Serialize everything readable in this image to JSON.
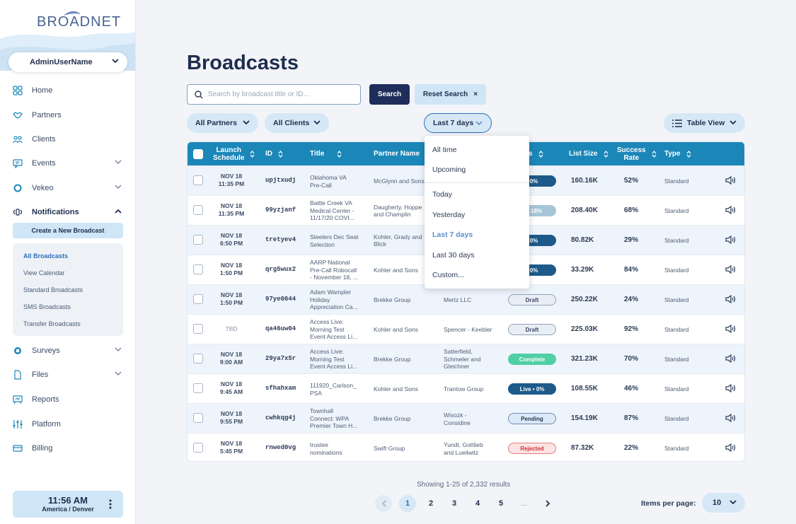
{
  "app": {
    "logo": "BROADNET"
  },
  "user": {
    "name": "AdminUserName"
  },
  "nav": {
    "home": "Home",
    "partners": "Partners",
    "clients": "Clients",
    "events": "Events",
    "vekeo": "Vekeo",
    "notifications": "Notifications",
    "create_broadcast": "Create a New Broadcast",
    "sub": {
      "all": "All Broadcasts",
      "calendar": "View Calendar",
      "standard": "Standard Broadcasts",
      "sms": "SMS Broadcasts",
      "transfer": "Transfer Broadcasts"
    },
    "surveys": "Surveys",
    "files": "Files",
    "reports": "Reports",
    "platform": "Platform",
    "billing": "Billing"
  },
  "clock": {
    "time": "11:56 AM",
    "zone": "America / Denver"
  },
  "page": {
    "title": "Broadcasts"
  },
  "search": {
    "placeholder": "Search by broadcast title or ID...",
    "button": "Search",
    "reset": "Reset Search",
    "reset_icon": "×"
  },
  "filters": {
    "partners": "All Partners",
    "clients": "All Clients",
    "date": "Last 7 days",
    "view": "Table View"
  },
  "table": {
    "headers": {
      "launch": [
        "Launch",
        "Schedule"
      ],
      "id": "ID",
      "title": "Title",
      "partner": "Partner Name",
      "status": "s",
      "list_size": "List Size",
      "success": [
        "Success",
        "Rate"
      ],
      "type": "Type"
    },
    "rows": [
      {
        "date": [
          "NOV 18",
          "11:35 PM"
        ],
        "id": "upjtxudj",
        "title": [
          "Oklahoma VA",
          "Pre-Call"
        ],
        "partner": [
          "McGlynn and Sons"
        ],
        "client": [],
        "status": "• 0%",
        "status_kind": "live",
        "size": "160.16K",
        "rate": "52%",
        "type": "Standard"
      },
      {
        "date": [
          "NOV 18",
          "11:35 PM"
        ],
        "id": "99yzjanf",
        "title": [
          "Battle Creek VA",
          "Medical Center -",
          "11/17/20 COVI..."
        ],
        "partner": [
          "Daugherty, Hoppe",
          "and Champlin"
        ],
        "client": [],
        "status": "d • 18%",
        "status_kind": "paused",
        "size": "208.40K",
        "rate": "68%",
        "type": "Standard"
      },
      {
        "date": [
          "NOV 18",
          "6:50 PM"
        ],
        "id": "tretyev4",
        "title": [
          "Steelers Dec Seat",
          "Selection"
        ],
        "partner": [
          "Kohler, Grady and",
          "Blick"
        ],
        "client": [],
        "status": "• 0%",
        "status_kind": "live",
        "size": "80.82K",
        "rate": "29%",
        "type": "Standard"
      },
      {
        "date": [
          "NOV 18",
          "1:50 PM"
        ],
        "id": "qrg5wux2",
        "title": [
          "AARP National",
          "Pre-Call Robocall",
          "- November 18, ..."
        ],
        "partner": [
          "Kohler and Sons"
        ],
        "client": [],
        "status": "• 0%",
        "status_kind": "live",
        "size": "33.29K",
        "rate": "84%",
        "type": "Standard"
      },
      {
        "date": [
          "NOV 18",
          "1:50 PM"
        ],
        "id": "97ye0644",
        "title": [
          "Adam Wampler",
          "Holiday",
          "Appreciation Ca..."
        ],
        "partner": [
          "Brekke Group"
        ],
        "client": [
          "Mertz LLC"
        ],
        "status": "Draft",
        "status_kind": "draft",
        "size": "250.22K",
        "rate": "24%",
        "type": "Standard"
      },
      {
        "date": [
          "TBD"
        ],
        "id": "qa46uw04",
        "title": [
          "Access Live:",
          "Morning Test",
          "Event Access Li..."
        ],
        "partner": [
          "Kohler and Sons"
        ],
        "client": [
          "Spencer - Keebler"
        ],
        "status": "Draft",
        "status_kind": "draft",
        "size": "225.03K",
        "rate": "92%",
        "type": "Standard"
      },
      {
        "date": [
          "NOV 18",
          "9:00 AM"
        ],
        "id": "29ya7x5r",
        "title": [
          "Access Live:",
          "Morning Test",
          "Event Access Li..."
        ],
        "partner": [
          "Brekke Group"
        ],
        "client": [
          "Satterfield,",
          "Schmeler and",
          "Gleichner"
        ],
        "status": "Complete",
        "status_kind": "complete",
        "size": "321.23K",
        "rate": "70%",
        "type": "Standard"
      },
      {
        "date": [
          "NOV 18",
          "9:45 AM"
        ],
        "id": "sfhahxam",
        "title": [
          "111920_Carlson_",
          "PSA"
        ],
        "partner": [
          "Kohler and Sons"
        ],
        "client": [
          "Trantow Group"
        ],
        "status": "Live • 0%",
        "status_kind": "live",
        "size": "108.55K",
        "rate": "46%",
        "type": "Standard"
      },
      {
        "date": [
          "NOV 18",
          "9:55 PM"
        ],
        "id": "cwhkqg4j",
        "title": [
          "Townhall",
          "Connect: WPA",
          "Premier Town H..."
        ],
        "partner": [
          "Brekke Group"
        ],
        "client": [
          "Wisozk -",
          "Considine"
        ],
        "status": "Pending",
        "status_kind": "pending",
        "size": "154.19K",
        "rate": "87%",
        "type": "Standard"
      },
      {
        "date": [
          "NOV 18",
          "5:45 PM"
        ],
        "id": "rnwed0vg",
        "title": [
          "trustee",
          "nominations"
        ],
        "partner": [
          "Swift Group"
        ],
        "client": [
          "Yundt, Gottlieb",
          "and Lueilwitz"
        ],
        "status": "Rejected",
        "status_kind": "rejected",
        "size": "87.32K",
        "rate": "22%",
        "type": "Standard"
      }
    ]
  },
  "date_dropdown": {
    "options": [
      "All time",
      "Upcoming",
      "Today",
      "Yesterday",
      "Last 7 days",
      "Last 30 days",
      "Custom..."
    ],
    "selected": "Last 7 days"
  },
  "pagination": {
    "summary": "Showing 1-25 of 2,332 results",
    "pages": [
      "1",
      "2",
      "3",
      "4",
      "5",
      "..."
    ],
    "current": "1",
    "items_per_page_label": "Items per page:",
    "items_per_page": "10"
  },
  "colors": {
    "header": "#1b87b8",
    "navy": "#1f2d5a",
    "accent": "#2d6fb8",
    "complete": "#4fcfa4",
    "rejected": "#d0333a"
  },
  "icons": {
    "nav": [
      "grid-icon",
      "handshake-icon",
      "users-icon",
      "chat-icon",
      "vekeo-icon",
      "broadcast-icon",
      "surveys-icon",
      "file-icon",
      "reports-icon",
      "sliders-icon",
      "card-icon"
    ],
    "row": "speaker-icon"
  }
}
